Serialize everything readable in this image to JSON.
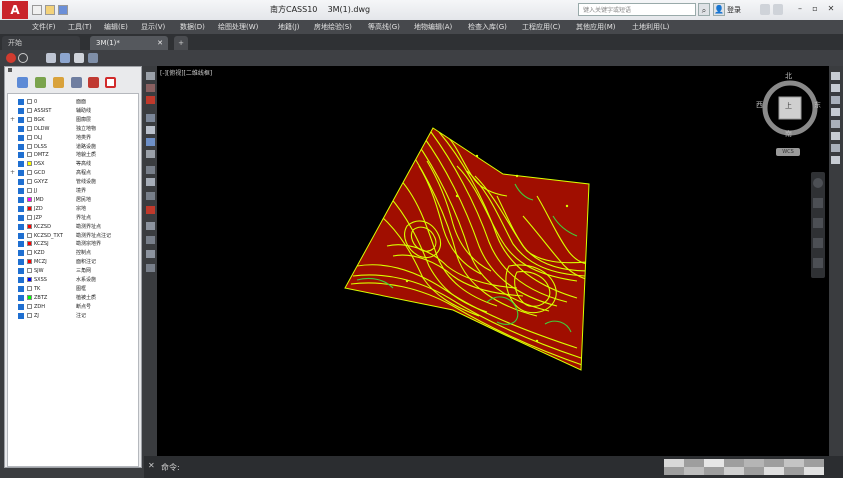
{
  "app": {
    "logo": "A",
    "title": "南方CASS10    3M(1).dwg"
  },
  "search": {
    "placeholder": "键入关键字或短语"
  },
  "account": {
    "login_label": "登录"
  },
  "window_controls": [
    "–",
    "▫",
    "✕"
  ],
  "menu": {
    "items": [
      "文件(F)",
      "工具(T)",
      "编辑(E)",
      "显示(V)",
      "数据(D)",
      "绘图处理(W)",
      "地籍(J)",
      "房地绘验(S)",
      "等高线(G)",
      "地物编辑(A)",
      "检查入库(G)",
      "工程应用(C)",
      "其他应用(M)",
      "土地利用(L)"
    ]
  },
  "tabs": [
    {
      "label": "开始",
      "active": false
    },
    {
      "label": "3M(1)*",
      "active": true
    },
    {
      "label": "+",
      "active": false
    }
  ],
  "layers": [
    {
      "name": "0",
      "desc": "面面",
      "color": "#ffffff"
    },
    {
      "name": "ASSIST",
      "desc": "辅助线",
      "color": "#ffffff"
    },
    {
      "name": "BGK",
      "desc": "图廓层",
      "color": "#ffffff",
      "expand": "+"
    },
    {
      "name": "DLDW",
      "desc": "独立地物",
      "color": "#ffffff"
    },
    {
      "name": "DLJ",
      "desc": "地类界",
      "color": "#ffffff"
    },
    {
      "name": "DLSS",
      "desc": "道路设施",
      "color": "#ffffff"
    },
    {
      "name": "DMTZ",
      "desc": "地貌土质",
      "color": "#ffffff"
    },
    {
      "name": "DSX",
      "desc": "等高线",
      "color": "#ffff00"
    },
    {
      "name": "GCD",
      "desc": "高程点",
      "color": "#ffffff",
      "expand": "+"
    },
    {
      "name": "GXYZ",
      "desc": "管线设施",
      "color": "#ffffff"
    },
    {
      "name": "JJ",
      "desc": "境界",
      "color": "#ffffff"
    },
    {
      "name": "JMD",
      "desc": "居民地",
      "color": "#ff00ff"
    },
    {
      "name": "JZD",
      "desc": "宗地",
      "color": "#ff0000"
    },
    {
      "name": "JZP",
      "desc": "界址点",
      "color": "#ffffff"
    },
    {
      "name": "KCZSD",
      "desc": "勘测界址点",
      "color": "#ff0000"
    },
    {
      "name": "KCZSD_TXT",
      "desc": "勘测界址点注记",
      "color": "#ffffff"
    },
    {
      "name": "KCZSJ",
      "desc": "勘测宗地界",
      "color": "#ff0000"
    },
    {
      "name": "KZD",
      "desc": "控制点",
      "color": "#ffffff"
    },
    {
      "name": "MCZJ",
      "desc": "面积注记",
      "color": "#ff0000"
    },
    {
      "name": "SJW",
      "desc": "三角网",
      "color": "#ffffff"
    },
    {
      "name": "SXSS",
      "desc": "水系设施",
      "color": "#0000ff"
    },
    {
      "name": "TK",
      "desc": "图框",
      "color": "#ffffff"
    },
    {
      "name": "ZBTZ",
      "desc": "植被土质",
      "color": "#00ff00"
    },
    {
      "name": "ZDH",
      "desc": "断点号",
      "color": "#ffffff"
    },
    {
      "name": "ZJ",
      "desc": "注记",
      "color": "#ffffff"
    }
  ],
  "viewport": {
    "label": "[-][俯视][二维线框]"
  },
  "viewcube": {
    "north": "北",
    "south": "南",
    "east": "东",
    "west": "西",
    "top": "上",
    "ucs": "WCS"
  },
  "command": {
    "close": "✕",
    "prompt": "命令:"
  },
  "colors": {
    "terrain_fill": "#a00e00",
    "contour": "#d9ff00",
    "contour_green": "#3fd13a"
  }
}
